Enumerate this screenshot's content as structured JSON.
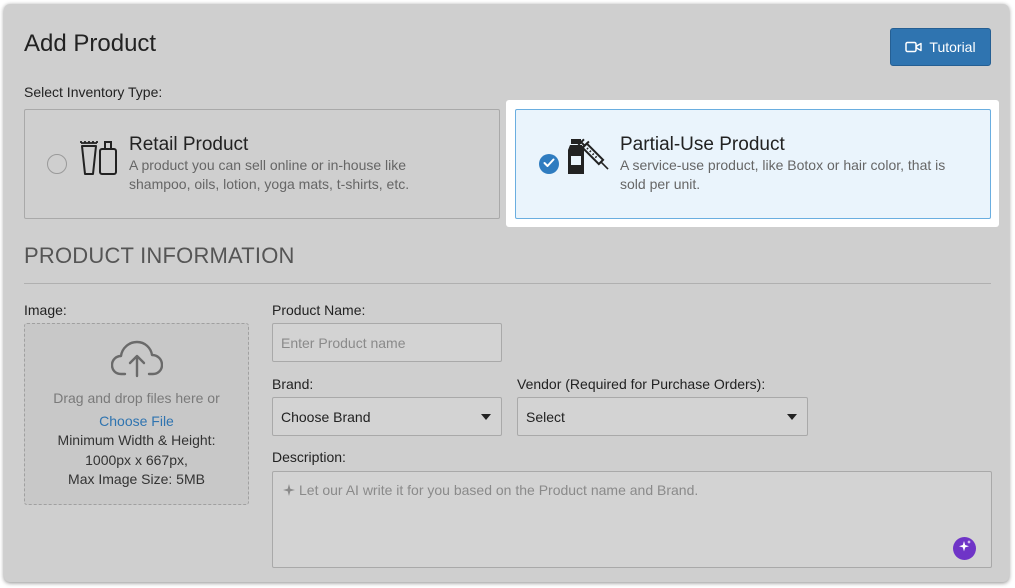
{
  "header": {
    "title": "Add Product",
    "tutorial_label": "Tutorial",
    "tutorial_icon": "video-camera-icon"
  },
  "inventory": {
    "label": "Select Inventory Type:",
    "options": [
      {
        "title": "Retail Product",
        "description": "A product you can sell online or in-house like shampoo, oils, lotion, yoga mats, t-shirts, etc.",
        "icon": "bottles-icon",
        "selected": false
      },
      {
        "title": "Partial-Use Product",
        "description": "A service-use product, like Botox or hair color, that is sold per unit.",
        "icon": "vial-syringe-icon",
        "selected": true
      }
    ]
  },
  "section": {
    "title": "PRODUCT INFORMATION"
  },
  "image": {
    "label": "Image:",
    "drop_hint": "Drag and drop files here or",
    "choose_file": "Choose File",
    "min_size_label": "Minimum Width & Height:",
    "min_size_value": "1000px x 667px,",
    "max_size": "Max Image Size: 5MB"
  },
  "product_name": {
    "label": "Product Name:",
    "value": "",
    "placeholder": "Enter Product name"
  },
  "brand": {
    "label": "Brand:",
    "selected": "Choose Brand"
  },
  "vendor": {
    "label": "Vendor (Required for Purchase Orders):",
    "selected": "Select"
  },
  "description": {
    "label": "Description:",
    "placeholder": "Let our AI write it for you based on the Product name and Brand."
  },
  "colors": {
    "primary": "#2f74b0",
    "selected_card_bg": "#eaf4fc",
    "ai_button": "#6f34c7"
  }
}
